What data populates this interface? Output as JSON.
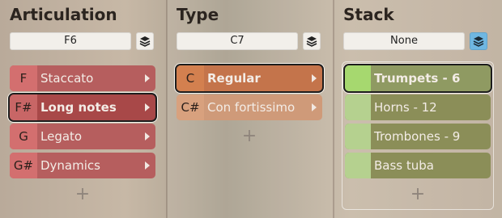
{
  "columns": [
    {
      "title": "Articulation",
      "field_value": "F6",
      "items": [
        {
          "key": "F",
          "label": "Staccato"
        },
        {
          "key": "F#",
          "label": "Long notes"
        },
        {
          "key": "G",
          "label": "Legato"
        },
        {
          "key": "G#",
          "label": "Dynamics"
        }
      ],
      "add_label": "+"
    },
    {
      "title": "Type",
      "field_value": "C7",
      "items": [
        {
          "key": "C",
          "label": "Regular"
        },
        {
          "key": "C#",
          "label": "Con fortissimo"
        }
      ],
      "add_label": "+"
    },
    {
      "title": "Stack",
      "field_value": "None",
      "items": [
        {
          "key": "",
          "label": "Trumpets - 6"
        },
        {
          "key": "",
          "label": "Horns - 12"
        },
        {
          "key": "",
          "label": "Trombones - 9"
        },
        {
          "key": "",
          "label": "Bass tuba"
        }
      ],
      "add_label": "+"
    }
  ],
  "icons": {
    "stack": "stack-layers-icon",
    "arrow": "chevron-right-icon"
  },
  "colors": {
    "articulation_key": "#d36f6f",
    "articulation_key_alt": "#c86666",
    "articulation_label": "#b65e5e",
    "articulation_label_selected": "#a84848",
    "type_key": "#d3804f",
    "type_label": "#c4744b",
    "type_key_alt": "#d8a17e",
    "type_label_alt": "#cf9a79",
    "stack_key": "#a6d86f",
    "stack_key_alt": "#b5d18f",
    "stack_label": "#8f9a62",
    "stack_label_alt": "#8b8e58",
    "stack_active_button": "#6fb7e2"
  }
}
